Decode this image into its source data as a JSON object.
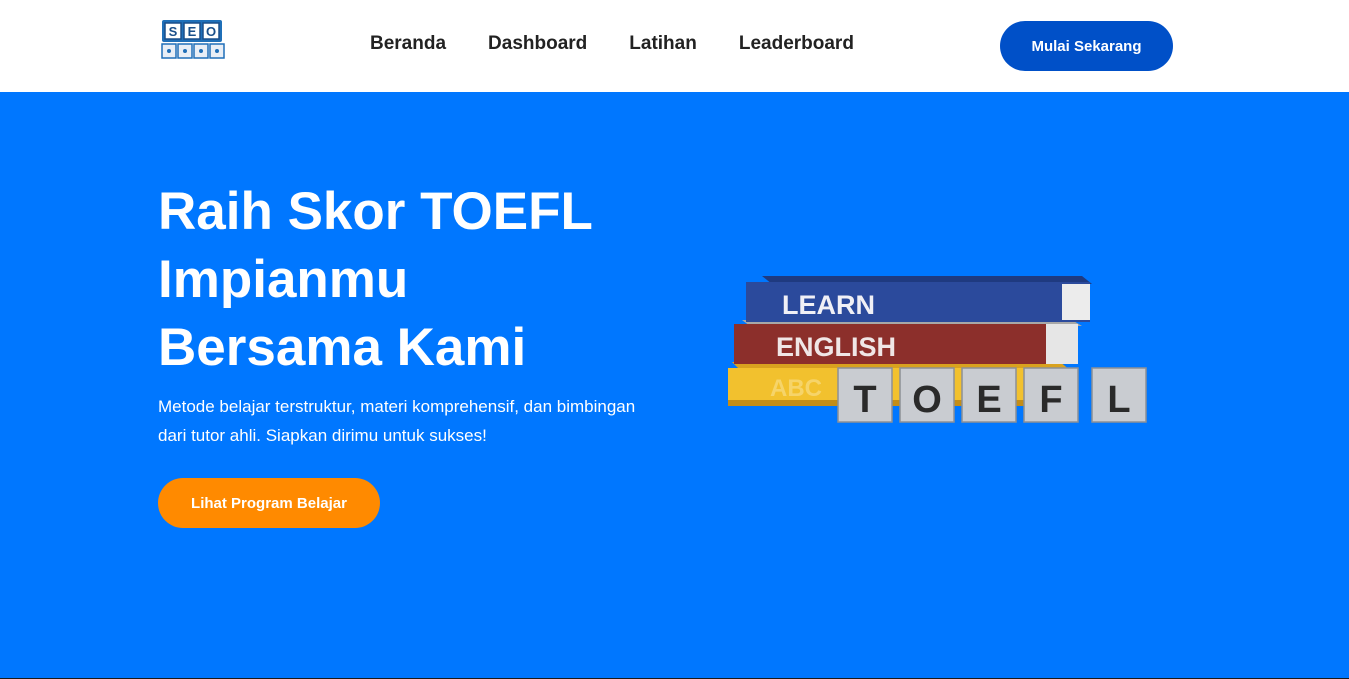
{
  "logo": {
    "letters": [
      "S",
      "E",
      "O"
    ]
  },
  "nav": {
    "links": [
      "Beranda",
      "Dashboard",
      "Latihan",
      "Leaderboard"
    ],
    "cta_label": "Mulai Sekarang"
  },
  "hero": {
    "title_lines": [
      "Raih Skor TOEFL",
      "Impianmu",
      "Bersama Kami"
    ],
    "description_lines": [
      "Metode belajar terstruktur, materi komprehensif, dan bimbingan",
      "dari tutor ahli. Siapkan dirimu untuk sukses!"
    ],
    "cta_label": "Lihat Program Belajar",
    "image": {
      "book_labels": [
        "LEARN",
        "ENGLISH",
        "ABC"
      ],
      "block_letters": [
        "T",
        "O",
        "E",
        "F",
        "L"
      ]
    }
  },
  "colors": {
    "hero_background": "#0077ff",
    "top_cta": "#0050c8",
    "hero_cta": "#ff8a00",
    "book_blue": "#2b4a9c",
    "book_red": "#8c2f2b",
    "book_yellow": "#f2c12e"
  }
}
